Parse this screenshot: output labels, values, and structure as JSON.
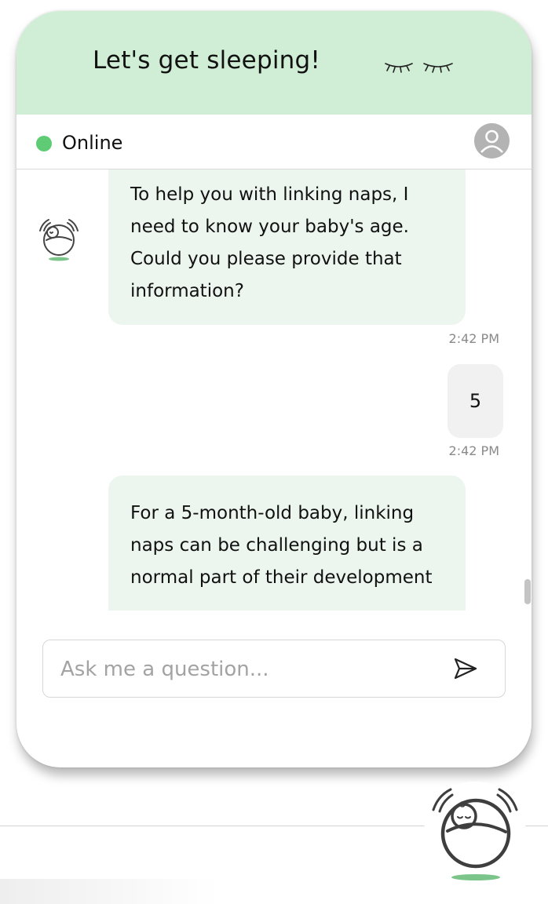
{
  "header": {
    "title": "Let's get sleeping!",
    "icon": "sleepy-eyes-icon"
  },
  "status": {
    "label": "Online",
    "color": "#5fcb75",
    "avatar_icon": "user-avatar-icon"
  },
  "messages": [
    {
      "sender": "bot",
      "text": "To help you with linking naps, I need to know your baby's age. Could you please provide that information?",
      "time": "2:42 PM"
    },
    {
      "sender": "user",
      "text": "5",
      "time": "2:42 PM"
    },
    {
      "sender": "bot",
      "text": "For a 5-month-old baby, linking naps can be challenging but is a normal part of their development"
    }
  ],
  "composer": {
    "placeholder": "Ask me a question...",
    "value": "",
    "send_icon": "send-icon"
  },
  "launcher": {
    "icon": "sleeping-baby-logo-icon"
  },
  "colors": {
    "header_bg": "#cfeed5",
    "bot_bubble": "#ecf6ee",
    "user_bubble": "#f1f1f1",
    "accent_green": "#7cc58a"
  }
}
